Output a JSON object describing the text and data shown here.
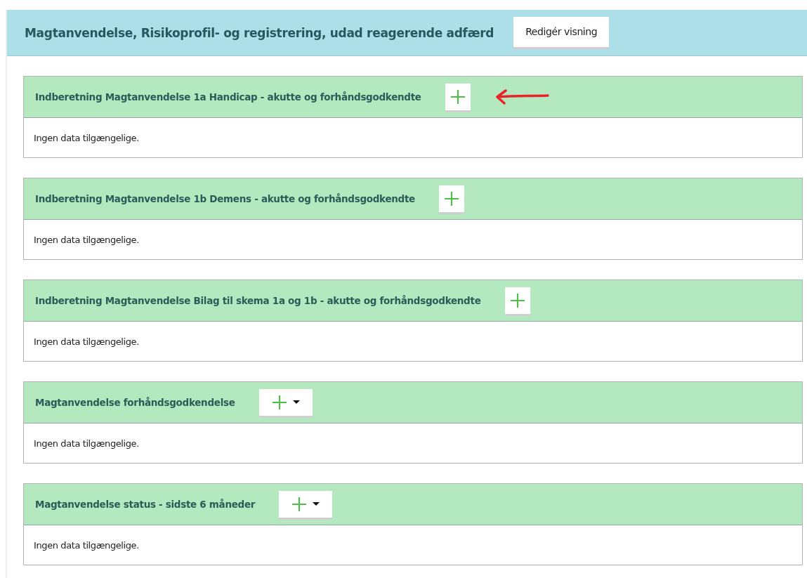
{
  "header": {
    "title": "Magtanvendelse, Risikoprofil- og registrering, udad reagerende adfærd",
    "button": "Redigér visning"
  },
  "panels": [
    {
      "title": "Indberetning Magtanvendelse 1a Handicap - akutte og forhåndsgodkendte",
      "kind": "plus",
      "arrow_marked": true,
      "body": "Ingen data tilgængelige."
    },
    {
      "title": "Indberetning Magtanvendelse 1b Demens - akutte og forhåndsgodkendte",
      "kind": "plus",
      "arrow_marked": false,
      "body": "Ingen data tilgængelige."
    },
    {
      "title": "Indberetning Magtanvendelse Bilag til skema 1a og 1b - akutte og forhåndsgodkendte",
      "kind": "plus",
      "arrow_marked": false,
      "body": "Ingen data tilgængelige."
    },
    {
      "title": "Magtanvendelse forhåndsgodkendelse",
      "kind": "plus-menu",
      "arrow_marked": false,
      "body": "Ingen data tilgængelige."
    },
    {
      "title": "Magtanvendelse status - sidste 6 måneder",
      "kind": "plus-menu",
      "arrow_marked": false,
      "body": "Ingen data tilgængelige."
    }
  ]
}
